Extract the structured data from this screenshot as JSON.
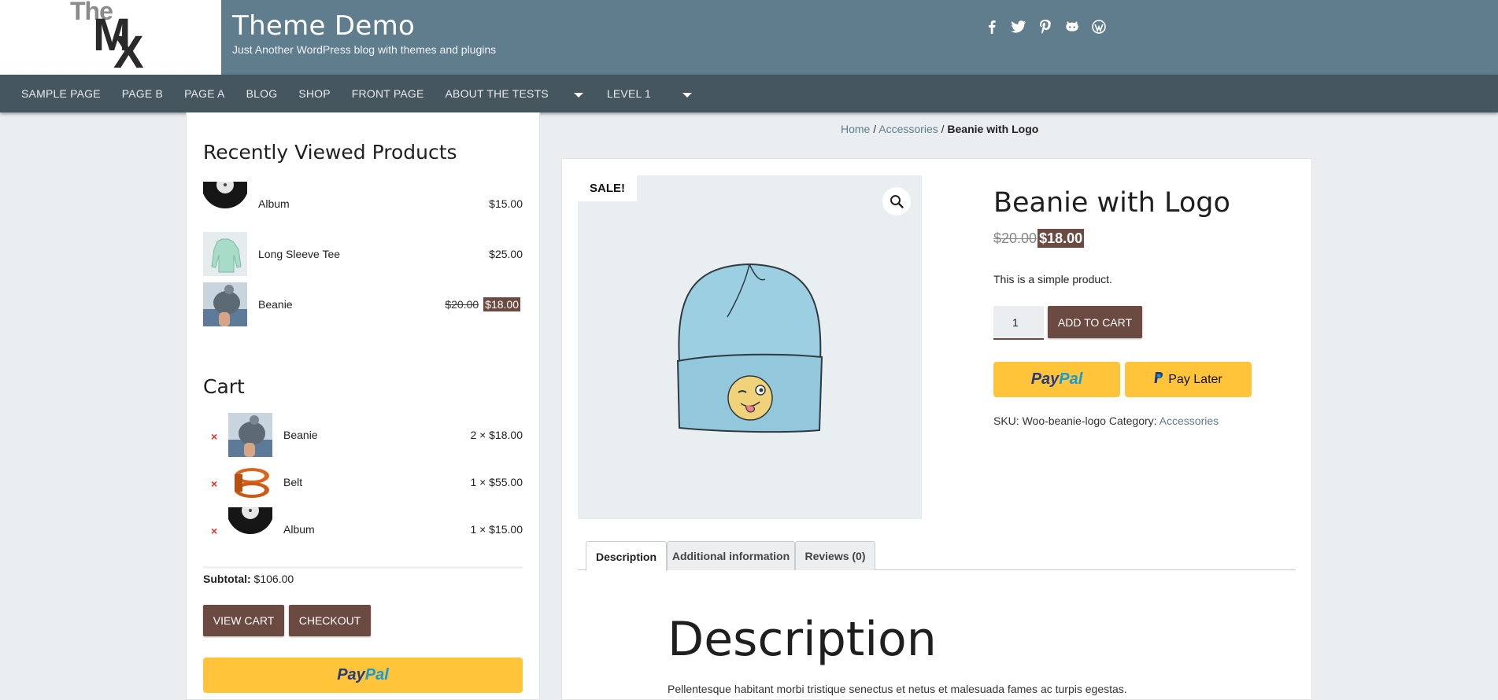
{
  "site": {
    "logo_top": "The",
    "logo_m": "M",
    "logo_x": "X",
    "title": "Theme Demo",
    "tagline": "Just Another WordPress blog with themes and plugins",
    "social_icons": [
      "facebook-icon",
      "twitter-icon",
      "pinterest-icon",
      "github-icon",
      "wordpress-icon"
    ]
  },
  "nav": {
    "items": [
      "SAMPLE PAGE",
      "PAGE B",
      "PAGE A",
      "BLOG",
      "SHOP",
      "FRONT PAGE",
      "ABOUT THE TESTS",
      "LEVEL 1"
    ]
  },
  "sidebar": {
    "recent_title": "Recently Viewed Products",
    "recent": [
      {
        "name": "Album",
        "price": "$15.00"
      },
      {
        "name": "Long Sleeve Tee",
        "price": "$25.00"
      },
      {
        "name": "Beanie",
        "old_price": "$20.00",
        "new_price": "$18.00"
      }
    ],
    "cart_title": "Cart",
    "cart": [
      {
        "remove": "×",
        "name": "Beanie",
        "qty": "2 × $18.00"
      },
      {
        "remove": "×",
        "name": "Belt",
        "qty": "1 × $55.00"
      },
      {
        "remove": "×",
        "name": "Album",
        "qty": "1 × $15.00"
      }
    ],
    "subtotal_label": "Subtotal:",
    "subtotal_value": "$106.00",
    "view_cart": "VIEW CART",
    "checkout": "CHECKOUT",
    "paypal_a": "Pay",
    "paypal_b": "Pal"
  },
  "breadcrumb": {
    "home": "Home",
    "sep": "/",
    "category": "Accessories",
    "current": "Beanie with Logo"
  },
  "product": {
    "sale_badge": "SALE!",
    "title": "Beanie with Logo",
    "old_price": "$20.00",
    "new_price": "$18.00",
    "short_desc": "This is a simple product.",
    "quantity": "1",
    "add_to_cart": "ADD TO CART",
    "paypal_a": "Pay",
    "paypal_b": "Pal",
    "pay_later": "Pay Later",
    "sku_label": "SKU:",
    "sku": "Woo-beanie-logo",
    "category_label": "Category:",
    "category": "Accessories"
  },
  "tabs": [
    {
      "label": "Description",
      "active": true
    },
    {
      "label": "Additional information",
      "active": false
    },
    {
      "label": "Reviews (0)",
      "active": false
    }
  ],
  "description": {
    "heading": "Description",
    "text": "Pellentesque habitant morbi tristique senectus et netus et malesuada fames ac turpis egestas."
  },
  "colors": {
    "header": "#5f7d8c",
    "nav": "#46565f",
    "accent": "#6b4a42",
    "paypal": "#ffc439"
  }
}
